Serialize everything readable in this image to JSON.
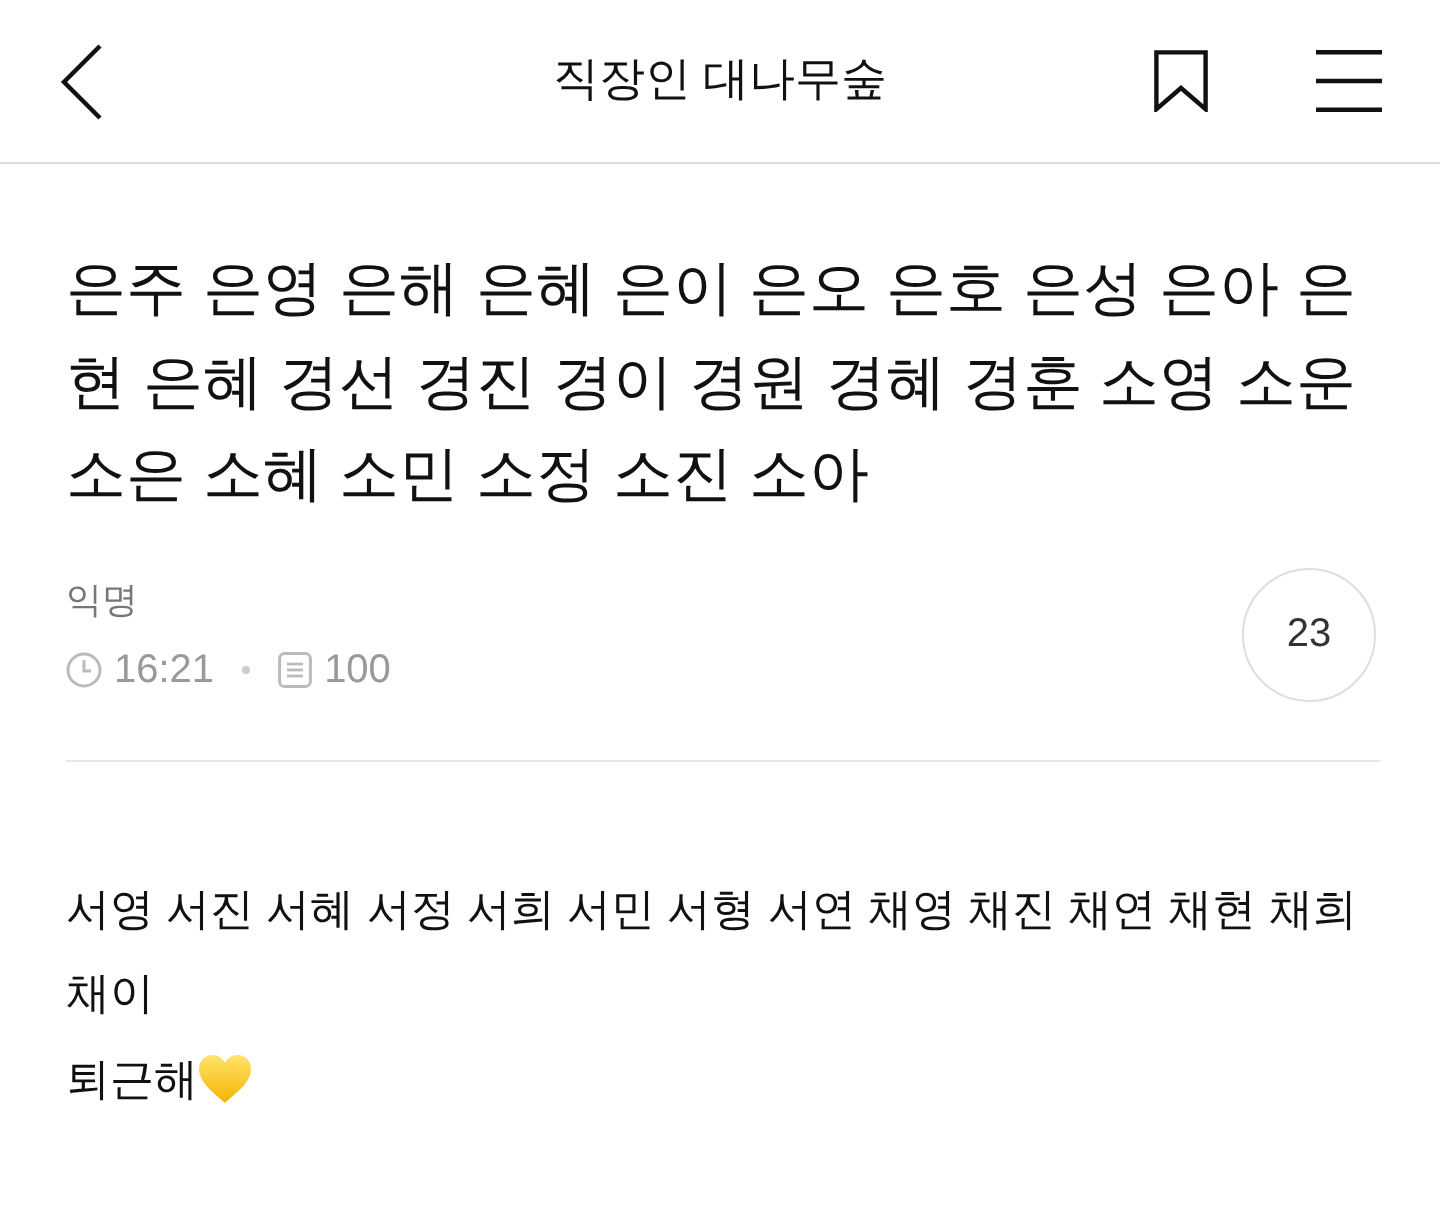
{
  "header": {
    "title": "직장인 대나무숲"
  },
  "post": {
    "title": "은주 은영 은해 은혜 은이 은오 은호 은성 은아 은현 은혜 경선 경진 경이 경원 경혜 경훈 소영 소운 소은 소혜 소민 소정 소진 소아",
    "author": "익명",
    "time": "16:21",
    "views": "100",
    "comment_count": "23"
  },
  "body": {
    "lines": [
      "서영 서진 서혜 서정 서희 서민 서형 서연 채영 채진 채연 채현 채희 채이",
      "퇴근해"
    ]
  }
}
